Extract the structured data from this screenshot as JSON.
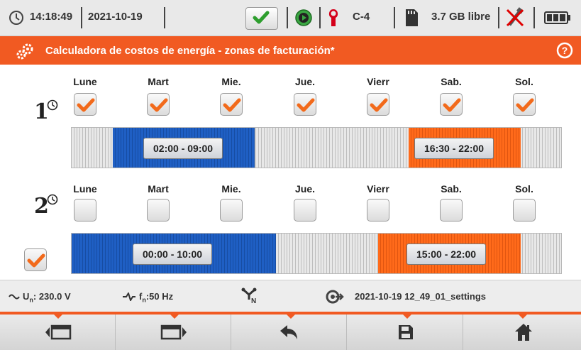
{
  "status": {
    "time": "14:18:49",
    "date": "2021-10-19",
    "channel": "C-4",
    "storage": "3.7 GB libre"
  },
  "header": {
    "title": "Calculadora de costos de energía - zonas de facturación*"
  },
  "zone1": {
    "days": [
      {
        "label": "Lune",
        "checked": true
      },
      {
        "label": "Mart",
        "checked": true
      },
      {
        "label": "Mie.",
        "checked": true
      },
      {
        "label": "Jue.",
        "checked": true
      },
      {
        "label": "Vierr",
        "checked": true
      },
      {
        "label": "Sab.",
        "checked": true
      },
      {
        "label": "Sol.",
        "checked": true
      }
    ],
    "ranges": [
      {
        "label": "02:00 - 09:00",
        "color": "blue"
      },
      {
        "label": "16:30 - 22:00",
        "color": "orange"
      }
    ]
  },
  "zone2": {
    "days": [
      {
        "label": "Lune",
        "checked": false
      },
      {
        "label": "Mart",
        "checked": false
      },
      {
        "label": "Mie.",
        "checked": false
      },
      {
        "label": "Jue.",
        "checked": false
      },
      {
        "label": "Vierr",
        "checked": false
      },
      {
        "label": "Sab.",
        "checked": false
      },
      {
        "label": "Sol.",
        "checked": false
      }
    ],
    "enabled": true,
    "ranges": [
      {
        "label": "00:00 - 10:00",
        "color": "blue"
      },
      {
        "label": "15:00 - 22:00",
        "color": "orange"
      }
    ]
  },
  "info": {
    "voltage": "U",
    "voltage_sub": "n",
    "voltage_val": ": 230.0 V",
    "freq": "f",
    "freq_sub": "n",
    "freq_val": ":50 Hz",
    "settings_file": "2021-10-19 12_49_01_settings"
  },
  "colors": {
    "accent": "#f15a22",
    "blue": "#1f5fc4",
    "orange": "#ff6a1a"
  },
  "icons": [
    "clock-icon",
    "check-icon",
    "play-icon",
    "clamp-icon",
    "sd-card-icon",
    "usb-disconnected-icon",
    "battery-icon",
    "gears-icon",
    "help-icon",
    "sine-icon",
    "frequency-icon",
    "network-icon",
    "settings-file-icon",
    "prev-screen-icon",
    "next-screen-icon",
    "back-icon",
    "save-icon",
    "home-icon"
  ]
}
